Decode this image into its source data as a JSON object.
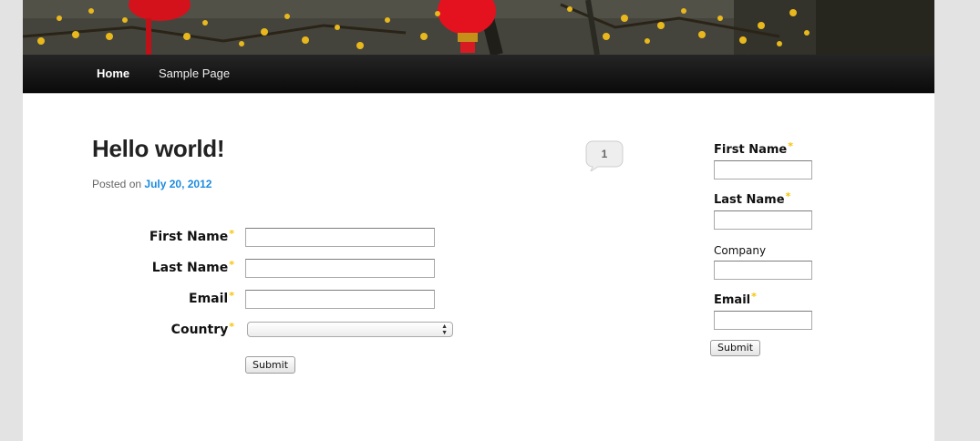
{
  "nav": {
    "items": [
      {
        "label": "Home"
      },
      {
        "label": "Sample Page"
      }
    ]
  },
  "post": {
    "title": "Hello world!",
    "posted_on_prefix": "Posted on",
    "date": "July 20, 2012",
    "comment_count": "1"
  },
  "main_form": {
    "fields": [
      {
        "label": "First Name",
        "required": true,
        "value": ""
      },
      {
        "label": "Last Name",
        "required": true,
        "value": ""
      },
      {
        "label": "Email",
        "required": true,
        "value": ""
      },
      {
        "label": "Country",
        "required": true,
        "selected": ""
      }
    ],
    "submit_label": "Submit"
  },
  "sidebar_form": {
    "fields": [
      {
        "label": "First Name",
        "required": true,
        "value": ""
      },
      {
        "label": "Last Name",
        "required": true,
        "value": ""
      },
      {
        "label": "Company",
        "required": false,
        "value": ""
      },
      {
        "label": "Email",
        "required": true,
        "value": ""
      }
    ],
    "submit_label": "Submit"
  },
  "required_marker": "*",
  "colors": {
    "accent_link": "#1b8be0",
    "required_star": "#f5c400",
    "nav_bg": "#111111",
    "page_bg": "#e3e3e3"
  }
}
